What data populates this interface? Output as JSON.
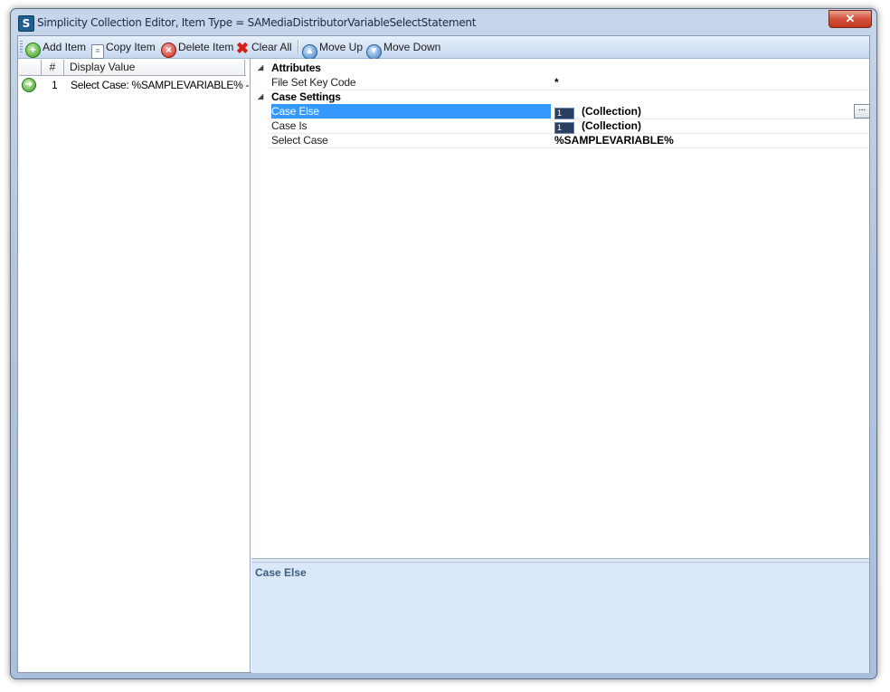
{
  "window": {
    "title": "Simplicity Collection Editor, Item Type = SAMediaDistributorVariableSelectStatement",
    "app_icon_letter": "S",
    "close_glyph": "✕"
  },
  "toolbar": {
    "add_item": "Add Item",
    "copy_item": "Copy Item",
    "delete_item": "Delete Item",
    "clear_all": "Clear All",
    "move_up": "Move Up",
    "move_down": "Move Down"
  },
  "items_grid": {
    "col_index": "#",
    "col_display": "Display Value",
    "rows": [
      {
        "index": "1",
        "display": "Select Case: %SAMPLEVARIABLE% - *"
      }
    ]
  },
  "property_grid": {
    "categories": [
      {
        "label": "Attributes",
        "properties": [
          {
            "name": "File Set Key Code",
            "value": "*"
          }
        ]
      },
      {
        "label": "Case Settings",
        "properties": [
          {
            "name": "Case Else",
            "box": "1",
            "value": "(Collection)",
            "selected": true
          },
          {
            "name": "Case Is",
            "box": "1",
            "value": "(Collection)"
          },
          {
            "name": "Select Case",
            "value": "%SAMPLEVARIABLE%"
          }
        ]
      }
    ],
    "ellipsis": "..."
  },
  "description": {
    "title": "Case Else"
  },
  "colors": {
    "selection": "#3399ff",
    "description_bg": "#dae7f8"
  }
}
